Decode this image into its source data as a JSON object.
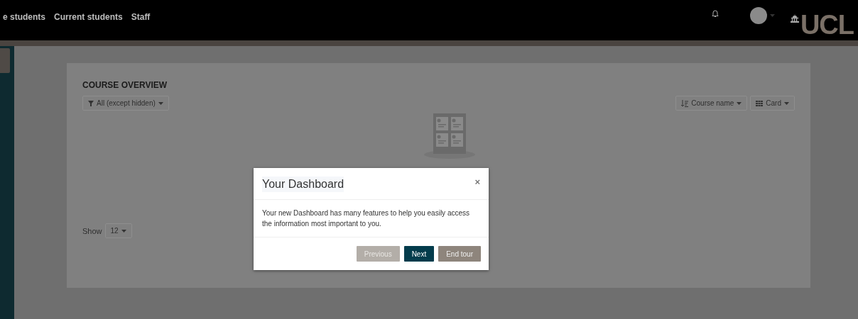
{
  "top_nav": {
    "links": [
      "e students",
      "Current students",
      "Staff"
    ],
    "logo_text": "UCL"
  },
  "course_overview": {
    "title": "COURSE OVERVIEW",
    "filter": "All (except hidden)",
    "sort": "Course name",
    "view": "Card",
    "show_label": "Show",
    "show_value": "12"
  },
  "tour_dialog": {
    "title": "Your Dashboard",
    "close": "×",
    "body": "Your new Dashboard has many features to help you easily access the information most important to you.",
    "buttons": [
      {
        "label": "Previous",
        "kind": "muted"
      },
      {
        "label": "Next",
        "kind": "primary"
      },
      {
        "label": "End tour",
        "kind": "secondary"
      }
    ]
  }
}
